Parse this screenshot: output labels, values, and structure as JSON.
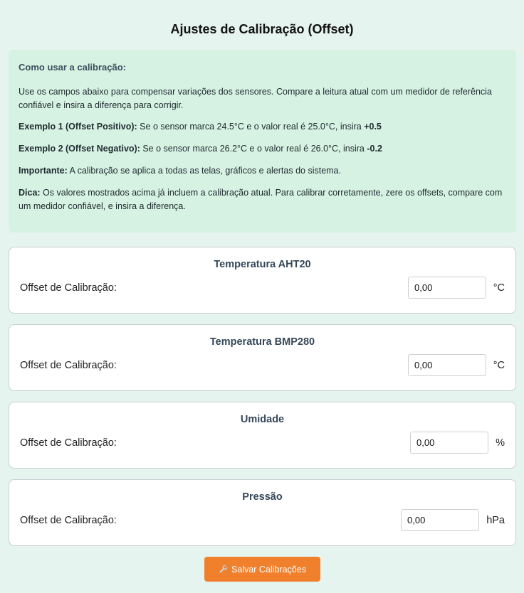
{
  "page": {
    "title": "Ajustes de Calibração (Offset)"
  },
  "info": {
    "heading": "Como usar a calibração:",
    "intro": "Use os campos abaixo para compensar variações dos sensores. Compare a leitura atual com um medidor de referência confiável e insira a diferença para corrigir.",
    "example1_label": "Exemplo 1 (Offset Positivo):",
    "example1_text": " Se o sensor marca 24.5°C e o valor real é 25.0°C, insira ",
    "example1_value": "+0.5",
    "example2_label": "Exemplo 2 (Offset Negativo):",
    "example2_text": " Se o sensor marca 26.2°C e o valor real é 26.0°C, insira ",
    "example2_value": "-0.2",
    "important_label": "Importante:",
    "important_text": " A calibração se aplica a todas as telas, gráficos e alertas do sistema.",
    "tip_label": "Dica:",
    "tip_text": " Os valores mostrados acima já incluem a calibração atual. Para calibrar corretamente, zere os offsets, compare com um medidor confiável, e insira a diferença."
  },
  "cards": [
    {
      "title": "Temperatura AHT20",
      "label": "Offset de Calibração:",
      "value": "0,00",
      "unit": "°C"
    },
    {
      "title": "Temperatura BMP280",
      "label": "Offset de Calibração:",
      "value": "0,00",
      "unit": "°C"
    },
    {
      "title": "Umidade",
      "label": "Offset de Calibração:",
      "value": "0,00",
      "unit": "%"
    },
    {
      "title": "Pressão",
      "label": "Offset de Calibração:",
      "value": "0,00",
      "unit": "hPa"
    }
  ],
  "save": {
    "label": "Salvar Calibrações",
    "icon": "wrench-icon",
    "color": "#f0802c"
  },
  "colors": {
    "background": "#e5f4ef",
    "info_background": "#d6f2e3",
    "card_title": "#35475a"
  }
}
